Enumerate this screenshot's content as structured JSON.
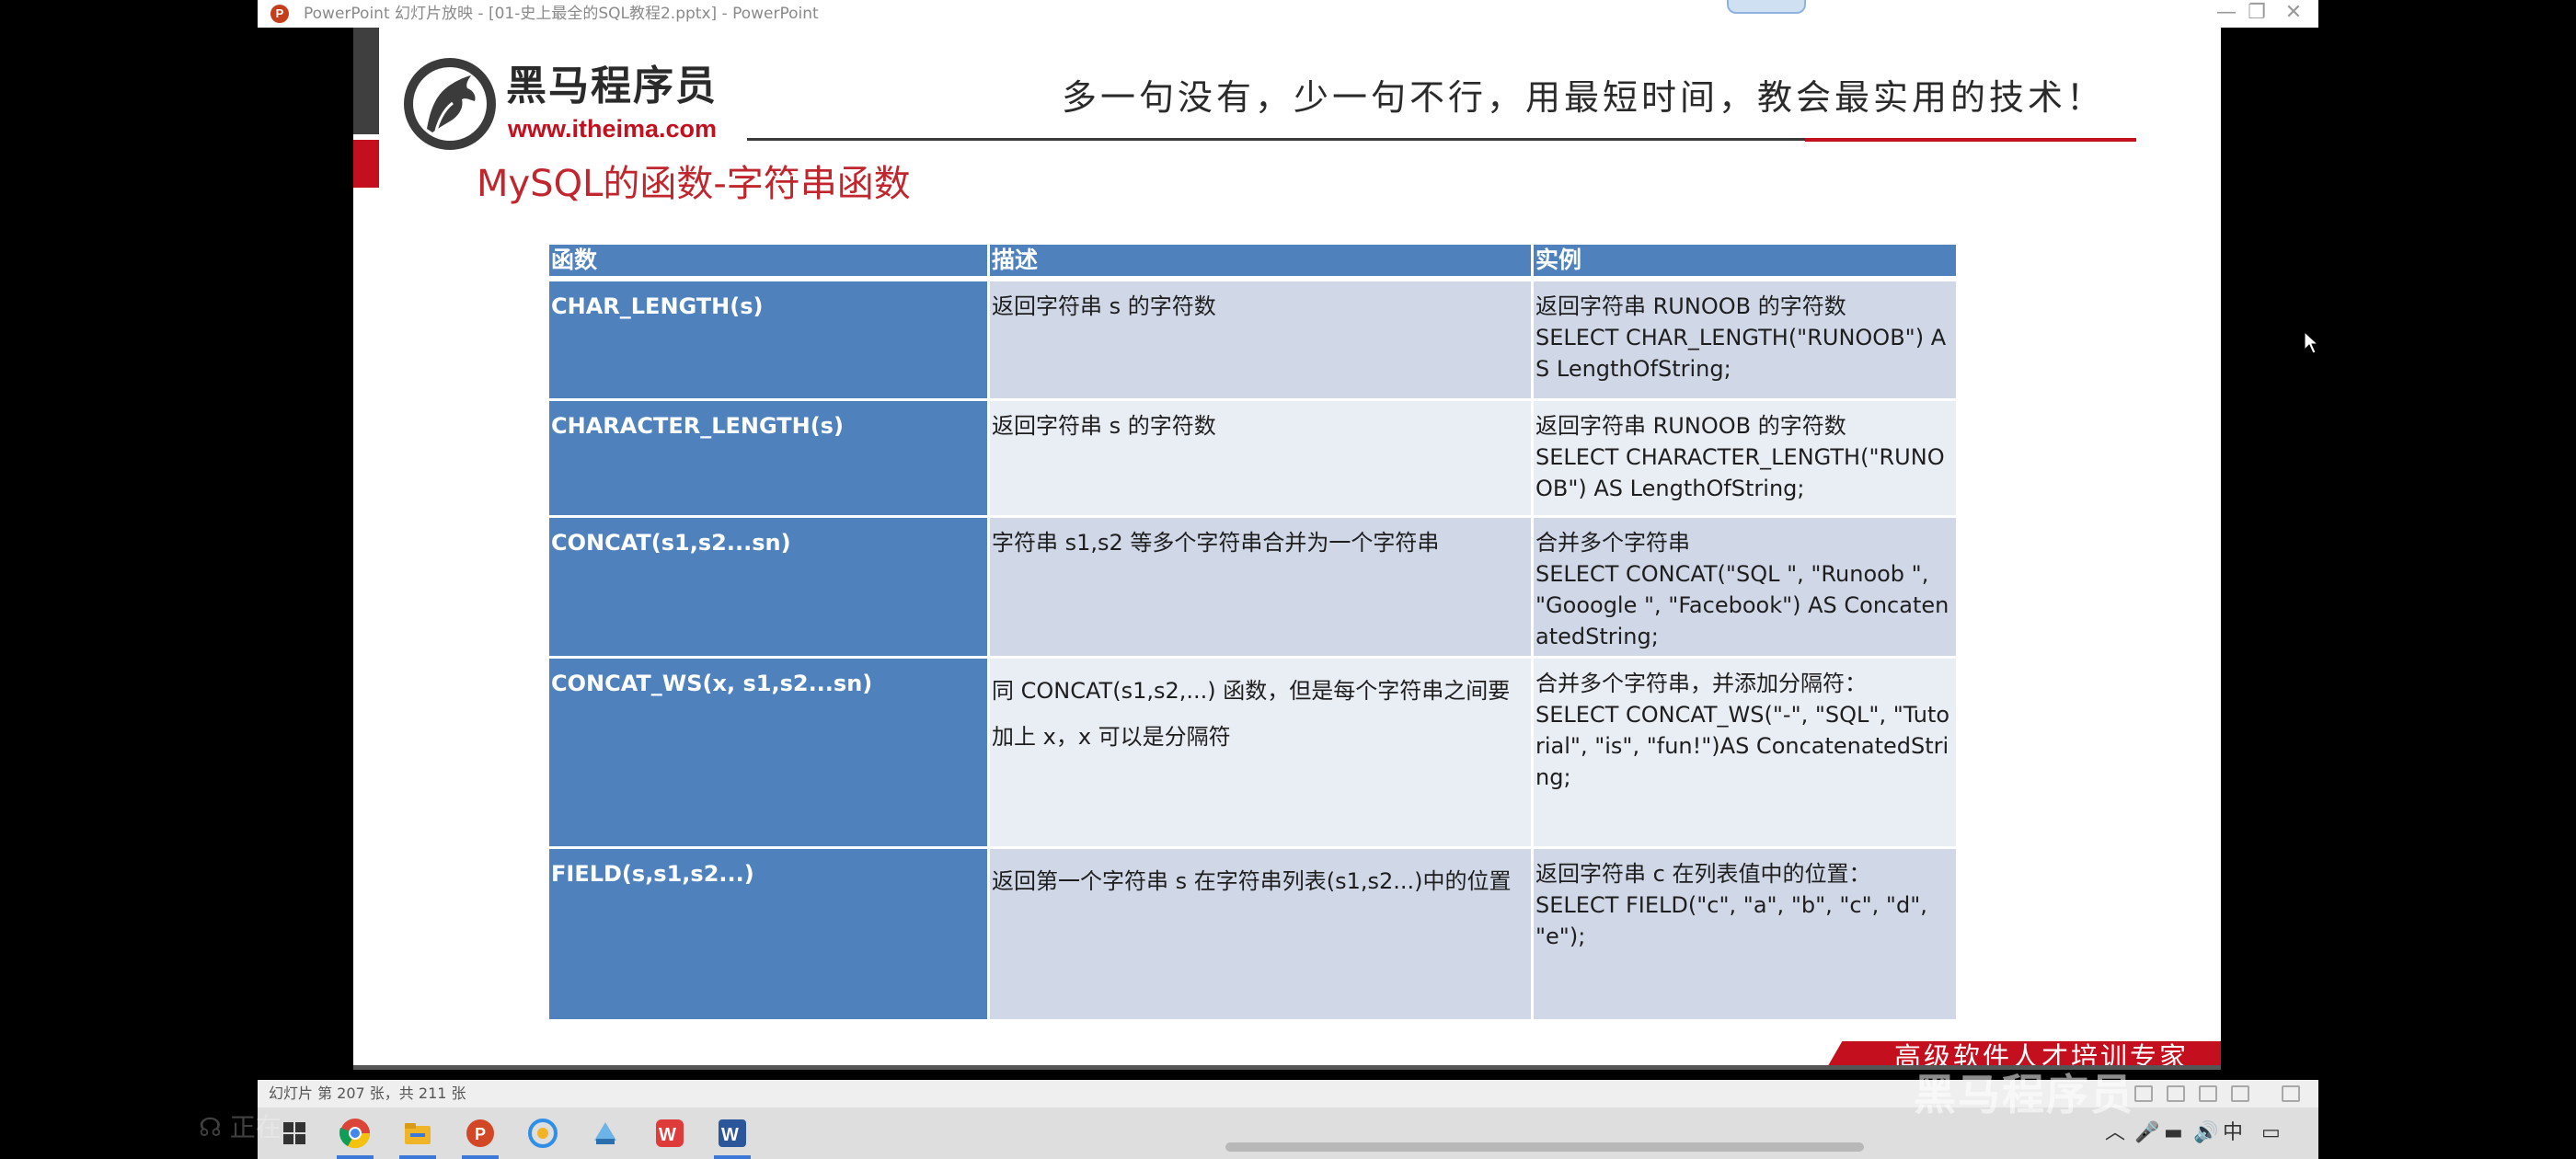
{
  "window": {
    "title": "PowerPoint 幻灯片放映 - [01-史上最全的SQL教程2.pptx] - PowerPoint",
    "minimize": "—",
    "restore": "❐",
    "close": "✕"
  },
  "slide": {
    "logo_name": "黑马程序员",
    "logo_url": "www.itheima.com",
    "slogan": "多一句没有，少一句不行，用最短时间，教会最实用的技术！",
    "heading": "MySQL的函数-字符串函数",
    "table": {
      "headers": [
        "函数",
        "描述",
        "实例"
      ],
      "rows": [
        {
          "func": "CHAR_LENGTH(s)",
          "desc": "返回字符串 s 的字符数",
          "example": [
            "返回字符串 RUNOOB 的字符数",
            "SELECT CHAR_LENGTH(\"RUNOOB\") AS LengthOfString;"
          ]
        },
        {
          "func": "CHARACTER_LENGTH(s)",
          "desc": "返回字符串 s 的字符数",
          "example": [
            "返回字符串 RUNOOB 的字符数",
            "SELECT CHARACTER_LENGTH(\"RUNOOB\") AS LengthOfString;"
          ]
        },
        {
          "func": "CONCAT(s1,s2...sn)",
          "desc": "字符串 s1,s2 等多个字符串合并为一个字符串",
          "example": [
            "合并多个字符串",
            "SELECT CONCAT(\"SQL \", \"Runoob \", \"Gooogle \", \"Facebook\") AS ConcatenatedString;"
          ]
        },
        {
          "func": "CONCAT_WS(x, s1,s2...sn)",
          "desc": "同 CONCAT(s1,s2,...) 函数，但是每个字符串之间要加上 x，x 可以是分隔符",
          "example": [
            "合并多个字符串，并添加分隔符：",
            "SELECT CONCAT_WS(\"-\", \"SQL\", \"Tutorial\", \"is\", \"fun!\")AS ConcatenatedString;"
          ]
        },
        {
          "func": "FIELD(s,s1,s2...)",
          "desc": "返回第一个字符串 s 在字符串列表(s1,s2...)中的位置",
          "example": [
            "返回字符串 c 在列表值中的位置：",
            "SELECT FIELD(\"c\", \"a\", \"b\", \"c\", \"d\", \"e\");"
          ]
        }
      ]
    },
    "banner": "高级软件人才培训专家"
  },
  "statusbar": {
    "slide_info": "幻灯片 第 207 张，共 211 张"
  },
  "taskbar": {
    "icons": [
      "windows-start-icon",
      "chrome-icon",
      "file-explorer-icon",
      "powerpoint-icon",
      "browser-icon",
      "app-icon",
      "wps-icon",
      "word-icon"
    ]
  },
  "overlay": {
    "left_text": "正在",
    "right_watermark": "黑马程序员"
  },
  "colors": {
    "accent_red": "#c40f1f",
    "table_blue": "#4f81bd",
    "row_light_1": "#d0d8e8",
    "row_light_2": "#e9edf4"
  }
}
